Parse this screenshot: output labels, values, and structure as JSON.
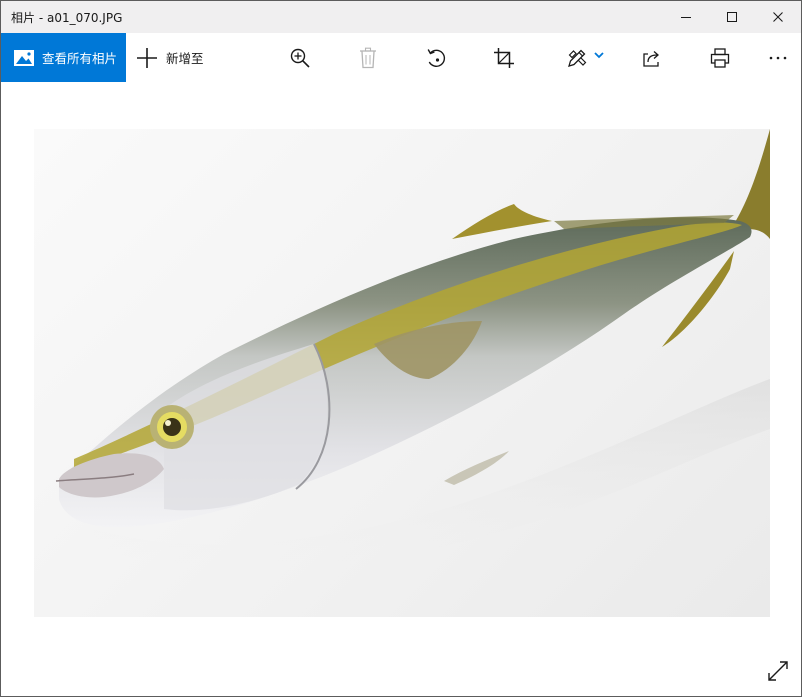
{
  "window": {
    "title": "相片 - a01_070.JPG",
    "controls": [
      "minimize-icon",
      "maximize-icon",
      "close-icon"
    ]
  },
  "toolbar": {
    "view_all_label": "查看所有相片",
    "view_all_icon": "photo-gallery-icon",
    "add_to_label": "新增至",
    "add_to_icon": "plus-icon",
    "tools": [
      {
        "name": "zoom-in",
        "icon": "zoom-in-icon",
        "enabled": true
      },
      {
        "name": "delete",
        "icon": "trash-icon",
        "enabled": false
      },
      {
        "name": "rotate",
        "icon": "rotate-icon",
        "enabled": true
      },
      {
        "name": "crop",
        "icon": "crop-icon",
        "enabled": true
      },
      {
        "name": "edit",
        "icon": "edit-pen-icon",
        "enabled": true,
        "has_dropdown": true
      },
      {
        "name": "share",
        "icon": "share-icon",
        "enabled": true
      },
      {
        "name": "print",
        "icon": "print-icon",
        "enabled": true
      },
      {
        "name": "more",
        "icon": "more-icon",
        "enabled": true
      }
    ],
    "accent_color": "#0078d7"
  },
  "viewer": {
    "image_subject": "yellowtail fish on white background",
    "fullscreen_icon": "expand-icon"
  }
}
